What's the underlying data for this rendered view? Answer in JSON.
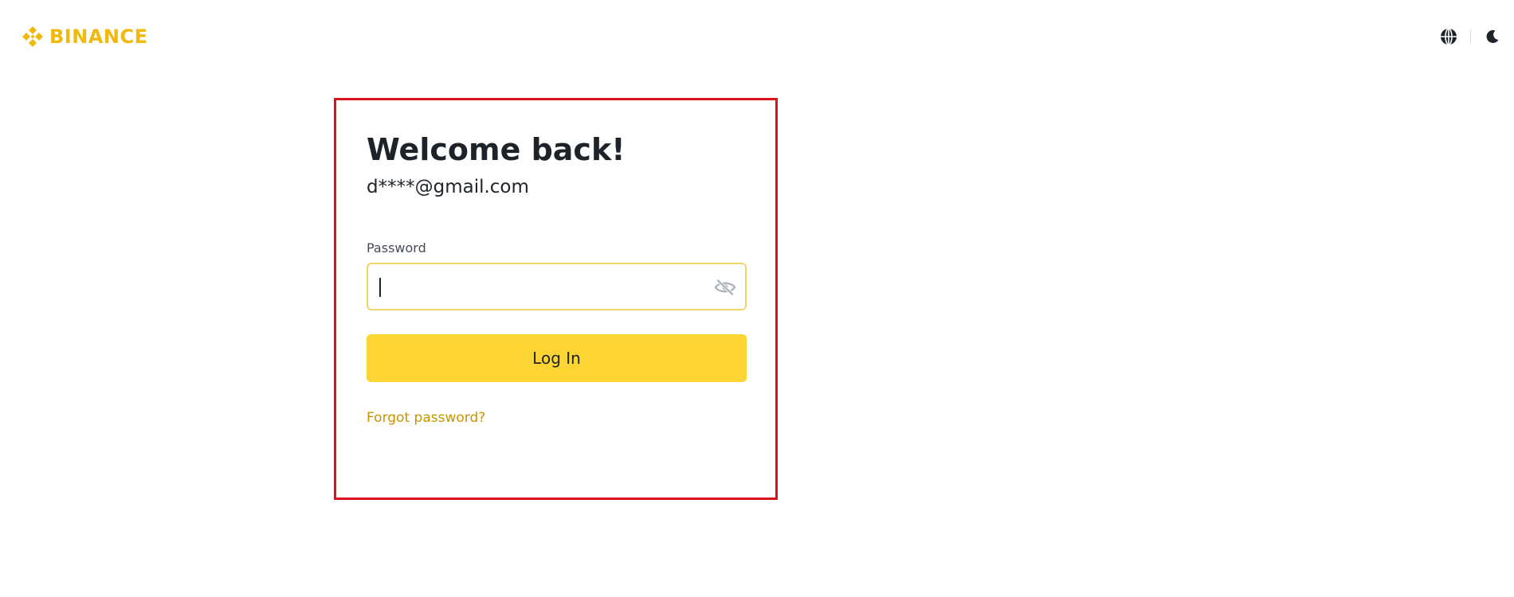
{
  "header": {
    "brand_name": "BINANCE",
    "brand_color": "#F0B90B",
    "actions": [
      {
        "icon": "globe-icon"
      },
      {
        "icon": "moon-icon"
      }
    ]
  },
  "login": {
    "title": "Welcome back!",
    "email": "d****@gmail.com",
    "password_label": "Password",
    "password_value": "",
    "toggle_icon": "eye-off-icon",
    "submit_label": "Log In",
    "forgot_label": "Forgot password?",
    "accent_color": "#FCD535",
    "link_color": "#C99400",
    "highlight_border_color": "#D9121C"
  }
}
